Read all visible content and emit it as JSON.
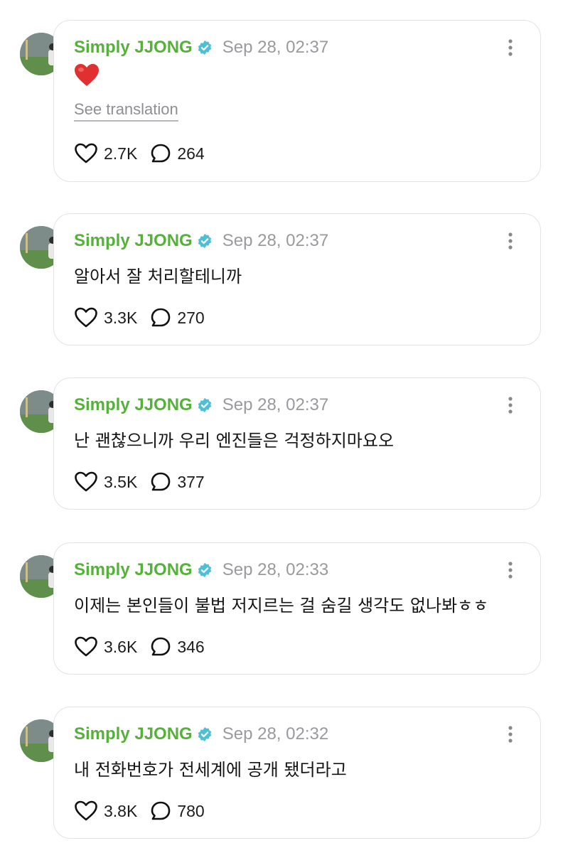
{
  "icons": {
    "verified": "verified-badge-icon",
    "more": "more-vertical-icon",
    "like": "heart-icon",
    "reply": "speech-bubble-icon",
    "reaction": "red-heart-emoji"
  },
  "colors": {
    "username": "#55b13a",
    "verified": "#4fbfd6",
    "timestamp": "#9a9a9e"
  },
  "posts": [
    {
      "username": "Simply JJONG",
      "time": "Sep 28, 02:37",
      "text": "❤️",
      "translation_link": "See translation",
      "likes": "2.7K",
      "replies": "264"
    },
    {
      "username": "Simply JJONG",
      "time": "Sep 28, 02:37",
      "text": "알아서 잘 처리할테니까",
      "likes": "3.3K",
      "replies": "270"
    },
    {
      "username": "Simply JJONG",
      "time": "Sep 28, 02:37",
      "text": "난 괜찮으니까 우리 엔진들은 걱정하지마요오",
      "likes": "3.5K",
      "replies": "377"
    },
    {
      "username": "Simply JJONG",
      "time": "Sep 28, 02:33",
      "text": "이제는 본인들이 불법 저지르는 걸 숨길 생각도 없나봐ㅎㅎ",
      "likes": "3.6K",
      "replies": "346"
    },
    {
      "username": "Simply JJONG",
      "time": "Sep 28, 02:32",
      "text": "내 전화번호가 전세계에 공개 됐더라고",
      "likes": "3.8K",
      "replies": "780"
    }
  ]
}
